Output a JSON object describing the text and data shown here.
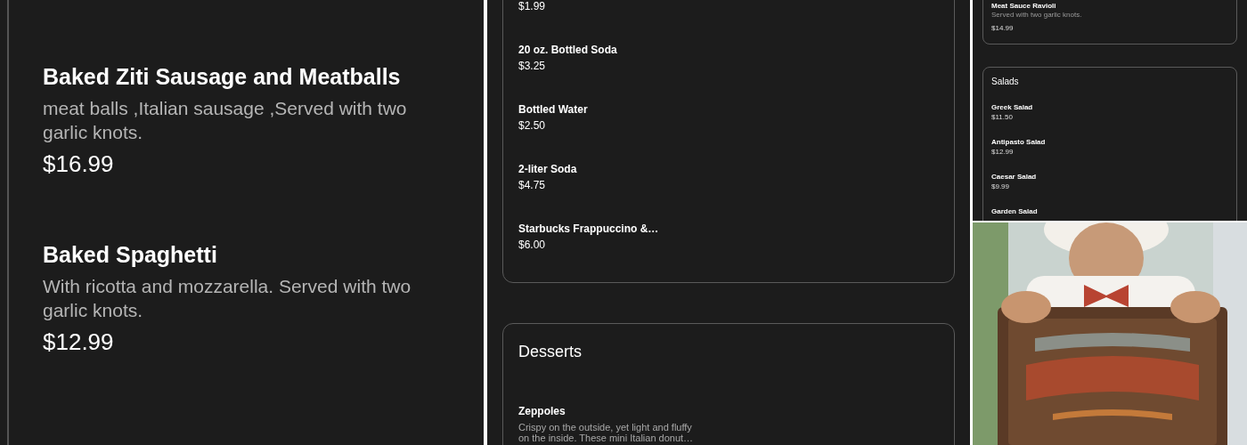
{
  "left_panel": {
    "items": [
      {
        "name": "Baked Ziti Sausage and Meatballs",
        "description": "meat balls ,Italian sausage ,Served with two garlic knots.",
        "price": "$16.99"
      },
      {
        "name": "Baked Spaghetti",
        "description": "With ricotta and mozzarella. Served with two garlic knots.",
        "price": "$12.99"
      }
    ]
  },
  "middle_panel": {
    "sections": [
      {
        "items": [
          {
            "price": "$1.99"
          },
          {
            "name": "20 oz. Bottled Soda",
            "price": "$3.25"
          },
          {
            "name": "Bottled Water",
            "price": "$2.50"
          },
          {
            "name": "2-liter Soda",
            "price": "$4.75"
          },
          {
            "name": "Starbucks Frappuccino &…",
            "price": "$6.00"
          }
        ]
      },
      {
        "title": "Desserts",
        "items": [
          {
            "name": "Zeppoles",
            "description": "Crispy on the outside, yet light and fluffy on the inside. These mini Italian donut…"
          }
        ]
      }
    ]
  },
  "right_panel": {
    "sections": [
      {
        "items": [
          {
            "name": "Meat Sauce Ravioli",
            "description": "Served with two garlic knots.",
            "price": "$14.99"
          }
        ]
      },
      {
        "title": "Salads",
        "items": [
          {
            "name": "Greek Salad",
            "price": "$11.50"
          },
          {
            "name": "Antipasto Salad",
            "price": "$12.99"
          },
          {
            "name": "Caesar Salad",
            "price": "$9.99"
          },
          {
            "name": "Garden Salad"
          }
        ]
      }
    ]
  }
}
